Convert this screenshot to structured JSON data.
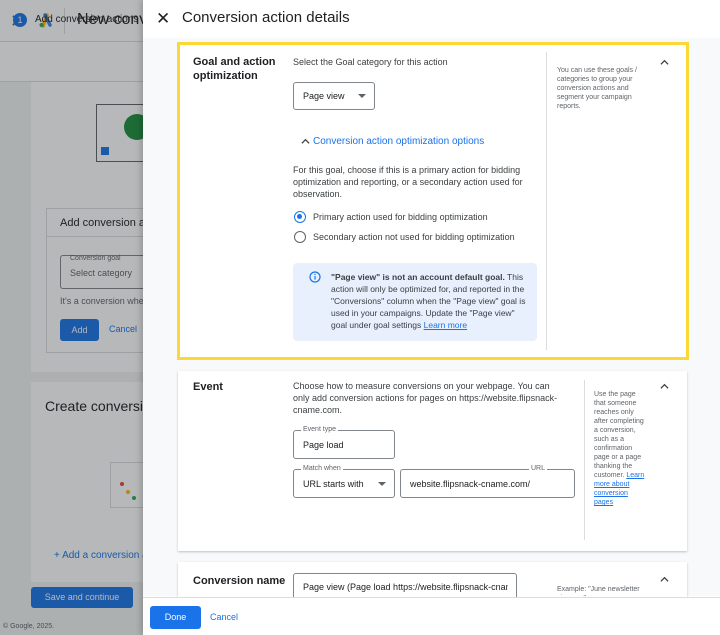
{
  "background": {
    "app_title": "New conve",
    "step_number": "1",
    "step_label": "Add conversion actions",
    "add_card_title": "Add conversion ac",
    "conversion_goal_label": "Conversion goal",
    "conversion_goal_placeholder": "Select category",
    "conversion_note": "It's a conversion whe",
    "add_button": "Add",
    "cancel_link": "Cancel",
    "create_title": "Create conversio",
    "add_conversion_link": "+ Add a conversion a",
    "save_button": "Save and continue",
    "copyright": "© Google, 2025."
  },
  "panel": {
    "title": "Conversion action details"
  },
  "goal_section": {
    "label": "Goal and action optimization",
    "prompt": "Select the Goal category for this action",
    "category_value": "Page view",
    "options_toggle": "Conversion action optimization options",
    "explanation": "For this goal, choose if this is a primary action for bidding optimization and reporting, or a secondary action used for observation.",
    "primary_option": "Primary action used for bidding optimization",
    "secondary_option": "Secondary action not used for bidding optimization",
    "primary_selected": true,
    "info_bold": "\"Page view\" is not an account default goal.",
    "info_text": " This action will only be optimized for, and reported in the \"Conversions\" column when the \"Page view\" goal is used in your campaigns. Update the \"Page view\" goal under goal settings ",
    "info_link": "Learn more",
    "help": "You can use these goals / categories to group your conversion actions and segment your campaign reports."
  },
  "event_section": {
    "label": "Event",
    "description": "Choose how to measure conversions on your webpage. You can only add conversion actions for pages on https://website.flipsnack-cname.com.",
    "event_type_label": "Event type",
    "event_type_value": "Page load",
    "match_label": "Match when",
    "match_value": "URL starts with",
    "url_label": "URL",
    "url_value": "website.flipsnack-cname.com/",
    "help": "Use the page that someone reaches only after completing a conversion, such as a confirmation page or a page thanking the customer.",
    "help_link": "Learn more about conversion pages"
  },
  "name_section": {
    "label": "Conversion name",
    "value": "Page view (Page load https://website.flipsnack-cname",
    "help": "Example: \"June newsletter sign-ups\""
  },
  "footer": {
    "done": "Done",
    "cancel": "Cancel"
  },
  "colors": {
    "accent": "#1a73e8",
    "highlight_border": "#fbd835",
    "info_background": "#e8f0fe"
  }
}
